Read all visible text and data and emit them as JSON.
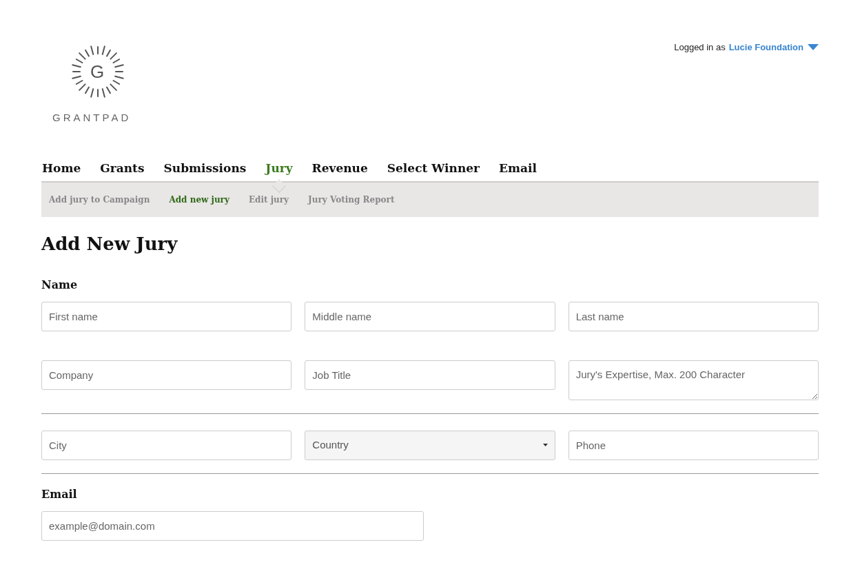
{
  "logo": {
    "letter": "G",
    "wordmark": "GRANTPAD"
  },
  "account": {
    "prefix": "Logged in as",
    "user": "Lucie Foundation"
  },
  "nav": [
    {
      "label": "Home",
      "selected": false
    },
    {
      "label": "Grants",
      "selected": false
    },
    {
      "label": "Submissions",
      "selected": false
    },
    {
      "label": "Jury",
      "selected": true
    },
    {
      "label": "Revenue",
      "selected": false
    },
    {
      "label": "Select Winner",
      "selected": false
    },
    {
      "label": "Email",
      "selected": false
    }
  ],
  "subnav": [
    {
      "label": "Add jury to Campaign",
      "selected": false
    },
    {
      "label": "Add new jury",
      "selected": true
    },
    {
      "label": "Edit jury",
      "selected": false
    },
    {
      "label": "Jury Voting Report",
      "selected": false
    }
  ],
  "heading": "Add New Jury",
  "sections": [
    {
      "label": "Name",
      "rows": [
        [
          {
            "kind": "text",
            "placeholder": "First name"
          },
          {
            "kind": "text",
            "placeholder": "Middle name"
          },
          {
            "kind": "text",
            "placeholder": "Last name"
          }
        ],
        [
          {
            "kind": "text",
            "placeholder": "Company"
          },
          {
            "kind": "text",
            "placeholder": "Job Title"
          },
          {
            "kind": "textarea",
            "placeholder": "Jury's Expertise, Max. 200 Character"
          }
        ]
      ]
    },
    {
      "rows": [
        [
          {
            "kind": "text",
            "placeholder": "City"
          },
          {
            "kind": "select",
            "placeholder": "Country"
          },
          {
            "kind": "text",
            "placeholder": "Phone"
          }
        ]
      ]
    },
    {
      "label": "Email",
      "rows": [
        [
          {
            "kind": "email",
            "placeholder": "example@domain.com"
          }
        ]
      ]
    }
  ]
}
